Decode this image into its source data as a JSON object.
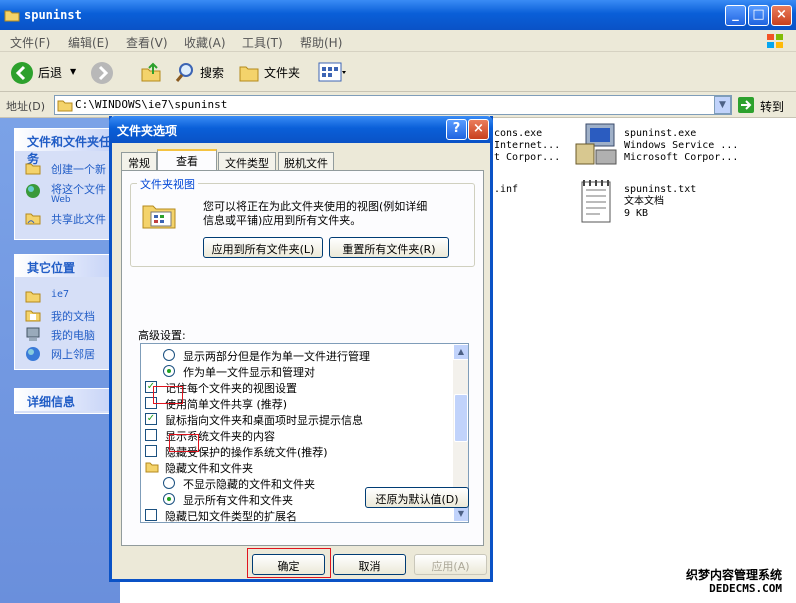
{
  "window": {
    "title": "spuninst"
  },
  "menu": [
    "文件(F)",
    "编辑(E)",
    "查看(V)",
    "收藏(A)",
    "工具(T)",
    "帮助(H)"
  ],
  "toolbar": {
    "back": "后退",
    "search": "搜索",
    "folders": "文件夹"
  },
  "address": {
    "label": "地址(D)",
    "path": "C:\\WINDOWS\\ie7\\spuninst",
    "go": "转到"
  },
  "leftpanel": {
    "tasks": {
      "title": "文件和文件夹任务",
      "items": [
        "创建一个新",
        "将这个文件",
        "Web",
        "共享此文件"
      ]
    },
    "places": {
      "title": "其它位置",
      "items": [
        "ie7",
        "我的文档",
        "我的电脑",
        "网上邻居"
      ]
    },
    "details": {
      "title": "详细信息"
    }
  },
  "files": {
    "partial1": [
      "cons.exe",
      "Internet...",
      "t Corpor..."
    ],
    "partial2": ".inf",
    "exe": [
      "spuninst.exe",
      "Windows Service ...",
      "Microsoft Corpor..."
    ],
    "txt": [
      "spuninst.txt",
      "文本文档",
      "9 KB"
    ]
  },
  "dialog": {
    "title": "文件夹选项",
    "tabs": [
      "常规",
      "查看",
      "文件类型",
      "脱机文件"
    ],
    "folderview": {
      "legend": "文件夹视图",
      "desc1": "您可以将正在为此文件夹使用的视图(例如详细",
      "desc2": "信息或平铺)应用到所有文件夹。",
      "apply_all": "应用到所有文件夹(L)",
      "reset_all": "重置所有文件夹(R)"
    },
    "advanced_label": "高级设置:",
    "settings": [
      {
        "type": "radio",
        "on": false,
        "indent": 2,
        "label": "显示两部分但是作为单一文件进行管理"
      },
      {
        "type": "radio",
        "on": true,
        "indent": 2,
        "label": "作为单一文件显示和管理对"
      },
      {
        "type": "check",
        "on": true,
        "indent": 1,
        "label": "记住每个文件夹的视图设置"
      },
      {
        "type": "check",
        "on": false,
        "indent": 1,
        "label": "使用简单文件共享 (推荐)"
      },
      {
        "type": "check",
        "on": true,
        "indent": 1,
        "label": "鼠标指向文件夹和桌面项时显示提示信息"
      },
      {
        "type": "check",
        "on": false,
        "indent": 1,
        "label": "显示系统文件夹的内容"
      },
      {
        "type": "check",
        "on": false,
        "indent": 1,
        "label": "隐藏受保护的操作系统文件(推荐)"
      },
      {
        "type": "folder",
        "on": false,
        "indent": 1,
        "label": "隐藏文件和文件夹"
      },
      {
        "type": "radio",
        "on": false,
        "indent": 2,
        "label": "不显示隐藏的文件和文件夹"
      },
      {
        "type": "radio",
        "on": true,
        "indent": 2,
        "label": "显示所有文件和文件夹"
      },
      {
        "type": "check",
        "on": false,
        "indent": 1,
        "label": "隐藏已知文件类型的扩展名"
      }
    ],
    "restore": "还原为默认值(D)",
    "ok": "确定",
    "cancel": "取消",
    "apply": "应用(A)"
  },
  "watermark": {
    "line1": "织梦内容管理系统",
    "line2": "DEDECMS.COM"
  }
}
